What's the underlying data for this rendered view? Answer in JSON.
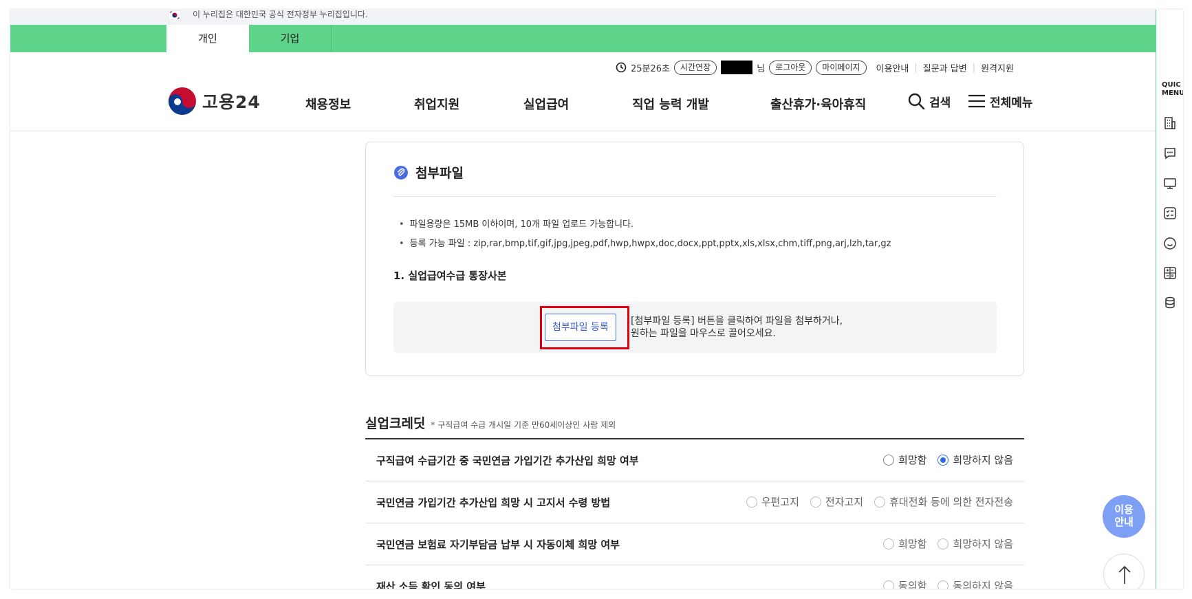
{
  "gov_banner": {
    "text": "이 누리집은 대한민국 공식 전자정부 누리집입니다."
  },
  "tabs": [
    {
      "label": "개인",
      "active": true
    },
    {
      "label": "기업",
      "active": false
    }
  ],
  "utility": {
    "timer": "25분26초",
    "extend": "시간연장",
    "user_suffix": "님",
    "logout": "로그아웃",
    "mypage": "마이페이지",
    "guide": "이용안내",
    "qna": "질문과 답변",
    "remote": "원격지원"
  },
  "logo": {
    "name": "고용24"
  },
  "nav": {
    "items": [
      "채용정보",
      "취업지원",
      "실업급여",
      "직업 능력 개발",
      "출산휴가·육아휴직"
    ],
    "search": "검색",
    "menu": "전체메뉴"
  },
  "attach": {
    "title": "첨부파일",
    "bullets": [
      "파일용량은 15MB 이하이며, 10개 파일 업로드 가능합니다.",
      "등록 가능 파일 : zip,rar,bmp,tif,gif,jpg,jpeg,pdf,hwp,hwpx,doc,docx,ppt,pptx,xls,xlsx,chm,tiff,png,arj,lzh,tar,gz"
    ],
    "item_title": "1. 실업급여수급 통장사본",
    "button": "첨부파일 등록",
    "drop_line1": "[첨부파일 등록] 버튼을 클릭하여 파일을 첨부하거나,",
    "drop_line2": "원하는 파일을 마우스로 끌어오세요."
  },
  "credit": {
    "title": "실업크레딧",
    "note": "* 구직급여 수급 개시일 기준 만60세이상인 사람 제외",
    "rows": [
      {
        "q": "구직급여 수급기간 중 국민연금 가입기간 추가산입 희망 여부",
        "opts": [
          "희망함",
          "희망하지 않음"
        ]
      },
      {
        "q": "국민연금 가입기간 추가산입 희망 시 고지서 수령 방법",
        "opts": [
          "우편고지",
          "전자고지",
          "휴대전화 등에 의한 전자전송"
        ]
      },
      {
        "q": "국민연금 보험료 자기부담금 납부 시 자동이체 희망 여부",
        "opts": [
          "희망함",
          "희망하지 않음"
        ]
      },
      {
        "q": "재산 소득 확인 동의 여부",
        "opts": [
          "동의함",
          "동의하지 않음"
        ]
      }
    ]
  },
  "quick_menu": {
    "label_1": "QUIC",
    "label_2": "MENU"
  },
  "float_guide": {
    "line1": "이용",
    "line2": "안내"
  },
  "colors": {
    "brand_green": "#61d48c",
    "accent_blue": "#3c5fd1",
    "highlight_red": "#e00010"
  }
}
